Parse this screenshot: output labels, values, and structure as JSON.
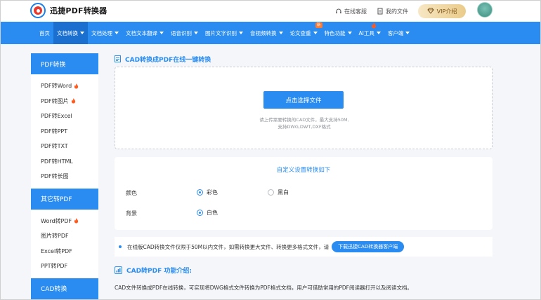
{
  "header": {
    "logo_text": "迅捷PDF转换器",
    "service_label": "在线客服",
    "docs_label": "我的文件",
    "vip_label": "VIP介绍"
  },
  "nav": {
    "items": [
      {
        "label": "首页"
      },
      {
        "label": "文档转换"
      },
      {
        "label": "文档处理"
      },
      {
        "label": "文档文本翻译"
      },
      {
        "label": "语音识别"
      },
      {
        "label": "图片文字识别"
      },
      {
        "label": "音视频转换"
      },
      {
        "label": "论文查重",
        "badge": "新"
      },
      {
        "label": "特色功能"
      },
      {
        "label": "AI工具"
      },
      {
        "label": "客户端"
      }
    ]
  },
  "sidebar": {
    "group1_title": "PDF转换",
    "group1_items": [
      {
        "label": "PDF转Word"
      },
      {
        "label": "PDF转图片"
      },
      {
        "label": "PDF转Excel"
      },
      {
        "label": "PDF转PPT"
      },
      {
        "label": "PDF转TXT"
      },
      {
        "label": "PDF转HTML"
      },
      {
        "label": "PDF转长图"
      }
    ],
    "group2_title": "其它转PDF",
    "group2_items": [
      {
        "label": "Word转PDF"
      },
      {
        "label": "图片转PDF"
      },
      {
        "label": "Excel转PDF"
      },
      {
        "label": "PPT转PDF"
      }
    ],
    "group3_title": "CAD转换"
  },
  "main": {
    "title": "CAD转换成PDF在线一键转换",
    "upload_button": "点击选择文件",
    "upload_hint_line1": "请上传需要转换的CAD文件，最大支持50M,",
    "upload_hint_line2": "支持DWG,DWT,DXF格式",
    "settings_title": "自定义设置转换如下",
    "color_label": "颜色",
    "color_option1": "彩色",
    "color_option2": "黑白",
    "bg_label": "背景",
    "bg_option1": "白色",
    "notice_text": "在线版CAD转换文件仅限于50M以内文件，如需转换更大文件、转换更多格式文件，请",
    "notice_button": "下载迅捷CAD转换器客户端",
    "intro_title": "CAD转PDF 功能介绍:",
    "intro_text": "CAD文件转换成PDF在线转换，可实现将DWG格式文件转换为PDF格式文档，用户可借助常用的PDF阅读器打开以及阅读文档。"
  },
  "colors": {
    "primary": "#2a8cf0",
    "nav_active": "#1a6fcf",
    "hot": "#ff5a1f"
  }
}
